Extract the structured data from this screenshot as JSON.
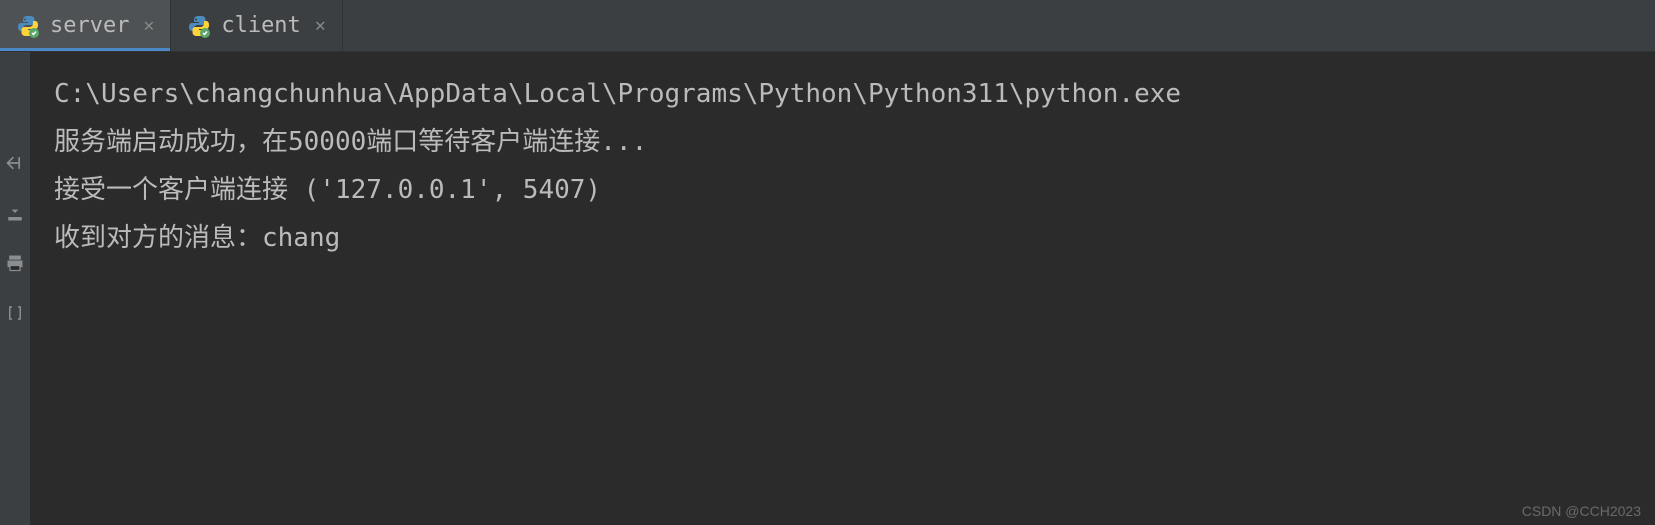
{
  "tabs": [
    {
      "label": "server",
      "active": true
    },
    {
      "label": "client",
      "active": false
    }
  ],
  "console": {
    "line1": "C:\\Users\\changchunhua\\AppData\\Local\\Programs\\Python\\Python311\\python.exe",
    "line2": "服务端启动成功，在50000端口等待客户端连接...",
    "line3": "接受一个客户端连接 ('127.0.0.1', 5407)",
    "line4": "收到对方的消息：chang"
  },
  "watermark": "CSDN @CCH2023"
}
